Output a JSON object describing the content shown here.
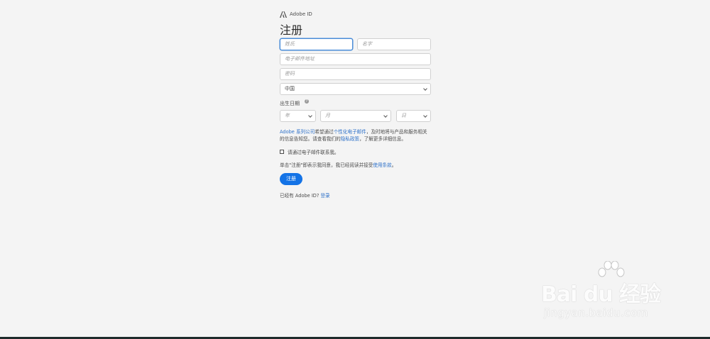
{
  "brand": {
    "name": "Adobe ID",
    "icon": "adobe-logo"
  },
  "title": "注册",
  "fields": {
    "last_name_placeholder": "姓氏",
    "first_name_placeholder": "名字",
    "email_placeholder": "电子邮件地址",
    "password_placeholder": "密码",
    "country_value": "中国"
  },
  "dob": {
    "label": "出生日期",
    "help_icon": "?",
    "year_placeholder": "年",
    "month_placeholder": "月",
    "day_placeholder": "日"
  },
  "notice": {
    "part1": "Adobe 系列公司",
    "part2": "希望通过",
    "part3": "个性化电子邮件",
    "part4": "，及时地将与产品和服务相关的信息告知您。请查看我们的",
    "part5": "隐私政策",
    "part6": "，了解更多详细信息。"
  },
  "consent": {
    "label": "请通过电子邮件联系我。"
  },
  "terms": {
    "part1": "单击\"注册\"即表示我同意，我已经阅读并接受",
    "part2": "使用条款",
    "part3": "。"
  },
  "signup_button": "注册",
  "existing": {
    "text": "已经有 Adobe ID?",
    "signin_link": "登录"
  },
  "watermark": {
    "main": "Bai du 经验",
    "sub": "jingyan.baidu.com"
  },
  "colors": {
    "accent": "#1473e6",
    "link": "#2d70c8",
    "background": "#f4f4f4"
  }
}
